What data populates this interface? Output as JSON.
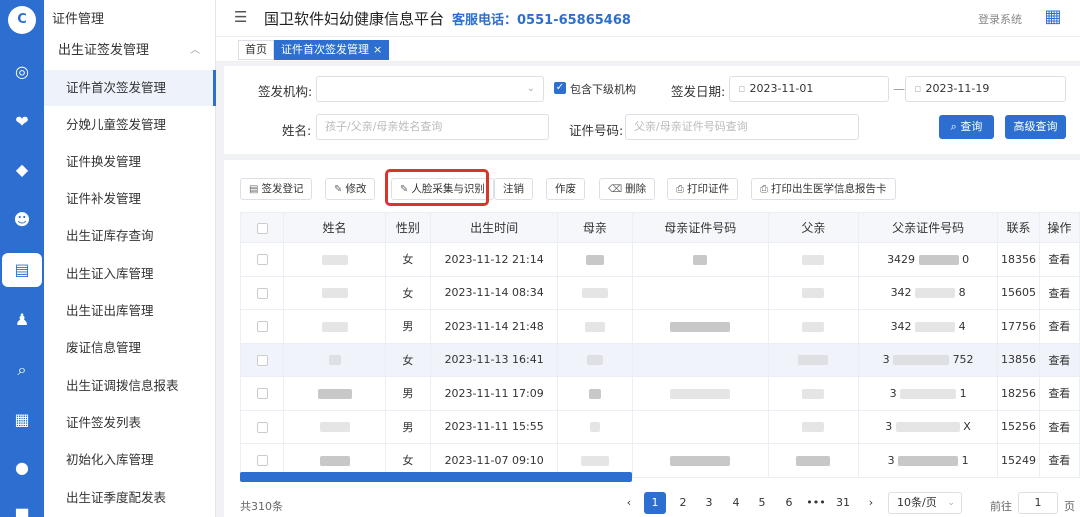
{
  "rail": {
    "logo": "C",
    "icons": [
      "dashboard-icon",
      "heart-icon",
      "certificate-icon",
      "baby-icon",
      "id-card-icon",
      "child-icon",
      "search-icon",
      "document-icon",
      "user-icon",
      "lock-icon"
    ]
  },
  "menu": {
    "title": "证件管理",
    "group": "出生证签发管理",
    "items": [
      "证件首次签发管理",
      "分娩儿童签发管理",
      "证件换发管理",
      "证件补发管理",
      "出生证库存查询",
      "出生证入库管理",
      "出生证出库管理",
      "废证信息管理",
      "出生证调拨信息报表",
      "证件签发列表",
      "初始化入库管理",
      "出生证季度配发表"
    ],
    "active_index": 0
  },
  "header": {
    "title": "国卫软件妇幼健康信息平台",
    "hotline": "客服电话：0551-65865468",
    "logout": "登录系统"
  },
  "tabs": [
    {
      "label": "首页"
    },
    {
      "label": "证件首次签发管理",
      "close": "×"
    }
  ],
  "filter": {
    "org_label": "签发机构:",
    "org_value": "",
    "include_sub_label": "包含下级机构",
    "include_sub_checked": true,
    "date_label": "签发日期:",
    "date_from": "2023-11-01",
    "date_to": "2023-11-19",
    "date_sep": "—",
    "name_label": "姓名:",
    "name_placeholder": "孩子/父亲/母亲姓名查询",
    "cert_label": "证件号码:",
    "cert_placeholder": "父亲/母亲证件号码查询",
    "search_btn": "查询",
    "advanced_btn": "高级查询"
  },
  "toolbar": {
    "buttons": [
      "签发登记",
      "修改",
      "人脸采集与识别",
      "注销",
      "作废",
      "删除",
      "打印证件",
      "打印出生医学信息报告卡"
    ]
  },
  "table": {
    "headers": [
      "",
      "姓名",
      "性别",
      "出生时间",
      "母亲",
      "母亲证件号码",
      "父亲",
      "父亲证件号码",
      "联系",
      "操作"
    ],
    "rows": [
      {
        "gender": "女",
        "birth": "2023-11-12 21:14",
        "father_id_prefix": "3429",
        "father_id_suffix": "0",
        "phone": "18356",
        "action": "查看"
      },
      {
        "gender": "女",
        "birth": "2023-11-14 08:34",
        "father_id_prefix": "342",
        "father_id_suffix": "8",
        "phone": "15605",
        "action": "查看"
      },
      {
        "gender": "男",
        "birth": "2023-11-14 21:48",
        "father_id_prefix": "342",
        "father_id_suffix": "4",
        "phone": "17756",
        "action": "查看"
      },
      {
        "gender": "女",
        "birth": "2023-11-13 16:41",
        "father_id_prefix": "3",
        "father_id_suffix": "752",
        "phone": "13856",
        "action": "查看"
      },
      {
        "gender": "男",
        "birth": "2023-11-11 17:09",
        "father_id_prefix": "3",
        "father_id_suffix": "1",
        "phone": "18256",
        "action": "查看"
      },
      {
        "gender": "男",
        "birth": "2023-11-11 15:55",
        "father_id_prefix": "3",
        "father_id_suffix": "X",
        "phone": "15256",
        "action": "查看"
      },
      {
        "gender": "女",
        "birth": "2023-11-07 09:10",
        "father_id_prefix": "3",
        "father_id_suffix": "1",
        "phone": "15249",
        "action": "查看"
      }
    ]
  },
  "pagination": {
    "total": "共310条",
    "prev": "‹",
    "next": "›",
    "pages": [
      "1",
      "2",
      "3",
      "4",
      "5",
      "6",
      "•••",
      "31"
    ],
    "current": "1",
    "page_size": "10条/页",
    "goto_label": "前往",
    "goto_value": "1",
    "goto_unit": "页"
  },
  "colors": {
    "primary": "#2d6fd0",
    "highlight_box": "#d9362b"
  }
}
